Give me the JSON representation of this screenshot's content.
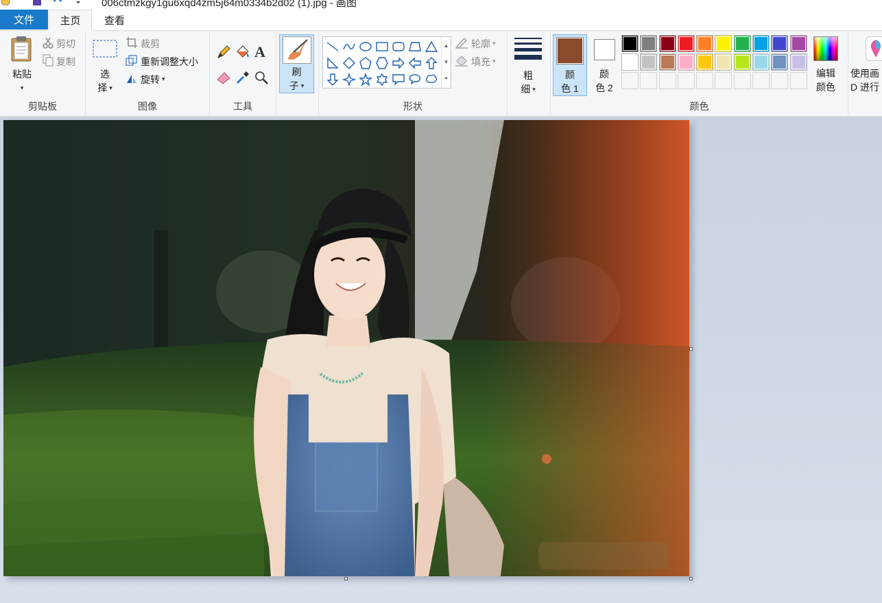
{
  "window": {
    "title": "006ctmzkgy1gu6xqd4zm5j64m0334b2d02 (1).jpg - 画图"
  },
  "tabs": [
    {
      "label": "文件"
    },
    {
      "label": "主页"
    },
    {
      "label": "查看"
    }
  ],
  "clipboard": {
    "paste": "粘贴",
    "cut": "剪切",
    "copy": "复制",
    "group": "剪贴板"
  },
  "image": {
    "select_line1": "选",
    "select_line2": "择",
    "crop": "裁剪",
    "resize": "重新调整大小",
    "rotate": "旋转",
    "group": "图像"
  },
  "tools": {
    "group": "工具"
  },
  "brushes": {
    "line1": "刷",
    "line2": "子"
  },
  "shapes": {
    "outline": "轮廓",
    "fill": "填充",
    "group": "形状"
  },
  "size": {
    "line1": "粗",
    "line2": "细"
  },
  "colors": {
    "color1_line1": "颜",
    "color1_line2": "色 1",
    "color2_line1": "颜",
    "color2_line2": "色 2",
    "edit_line1": "编辑",
    "edit_line2": "颜色",
    "paint3d_line1": "使用画",
    "paint3d_line2": "D 进行",
    "group": "颜色",
    "color1_value": "#8b4a2b",
    "color2_value": "#ffffff",
    "palette_row1": [
      "#000000",
      "#7f7f7f",
      "#880015",
      "#ed1c24",
      "#ff7f27",
      "#fff200",
      "#22b14c",
      "#00a2e8",
      "#3f48cc",
      "#a349a4"
    ],
    "palette_row2": [
      "#ffffff",
      "#c3c3c3",
      "#b97a57",
      "#ffaec9",
      "#ffc90e",
      "#efe4b0",
      "#b5e61d",
      "#99d9ea",
      "#7092be",
      "#c8bfe7"
    ]
  }
}
